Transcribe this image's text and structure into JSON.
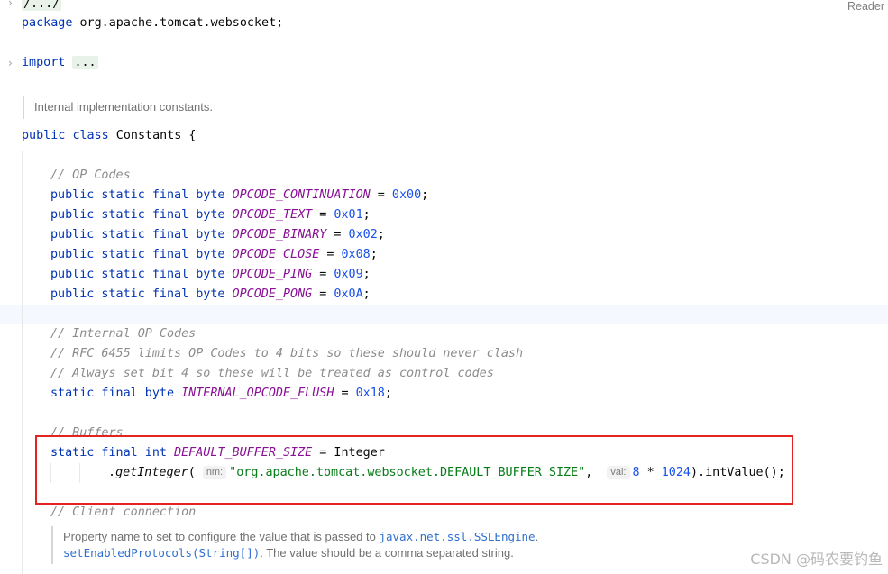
{
  "header": {
    "reader_label": "Reader"
  },
  "code": {
    "folded_comment": "/.../",
    "package_kw": "package",
    "package_name": " org.apache.tomcat.websocket;",
    "import_kw": "import",
    "import_folded": "...",
    "class_doc": "Internal implementation constants.",
    "class_decl": {
      "kw1": "public",
      "kw2": "class",
      "name": " Constants {"
    },
    "op_codes_comment": "// OP Codes",
    "modifiers_psfb": "public static final byte",
    "op_codes": [
      {
        "name": "OPCODE_CONTINUATION",
        "value": "0x00"
      },
      {
        "name": "OPCODE_TEXT",
        "value": "0x01"
      },
      {
        "name": "OPCODE_BINARY",
        "value": "0x02"
      },
      {
        "name": "OPCODE_CLOSE",
        "value": "0x08"
      },
      {
        "name": "OPCODE_PING",
        "value": "0x09"
      },
      {
        "name": "OPCODE_PONG",
        "value": "0x0A"
      }
    ],
    "internal_comments": [
      "// Internal OP Codes",
      "// RFC 6455 limits OP Codes to 4 bits so these should never clash",
      "// Always set bit 4 so these will be treated as control codes"
    ],
    "internal_modifiers": "static final byte",
    "internal_const": "INTERNAL_OPCODE_FLUSH",
    "internal_value": "0x18",
    "buffers_comment": "// Buffers",
    "buffer_modifiers": "static final int",
    "buffer_const": "DEFAULT_BUFFER_SIZE",
    "buffer_assign": " = Integer",
    "get_integer_prefix": ".",
    "get_integer_method": "getInteger",
    "hint_nm": "nm:",
    "buffer_prop_string": "\"org.apache.tomcat.websocket.DEFAULT_BUFFER_SIZE\"",
    "hint_val": "val:",
    "buffer_num1": "8",
    "buffer_mult": " * ",
    "buffer_num2": "1024",
    "buffer_tail": ").intValue();",
    "client_comment": "// Client connection",
    "client_doc_1": "Property name to set to configure the value that is passed to ",
    "client_doc_link1": "javax.net.ssl.SSLEngine",
    "client_doc_2_link": "setEnabledProtocols(String[])",
    "client_doc_2": ". The value should be a comma separated string."
  },
  "watermark": "CSDN @码农要钓鱼"
}
